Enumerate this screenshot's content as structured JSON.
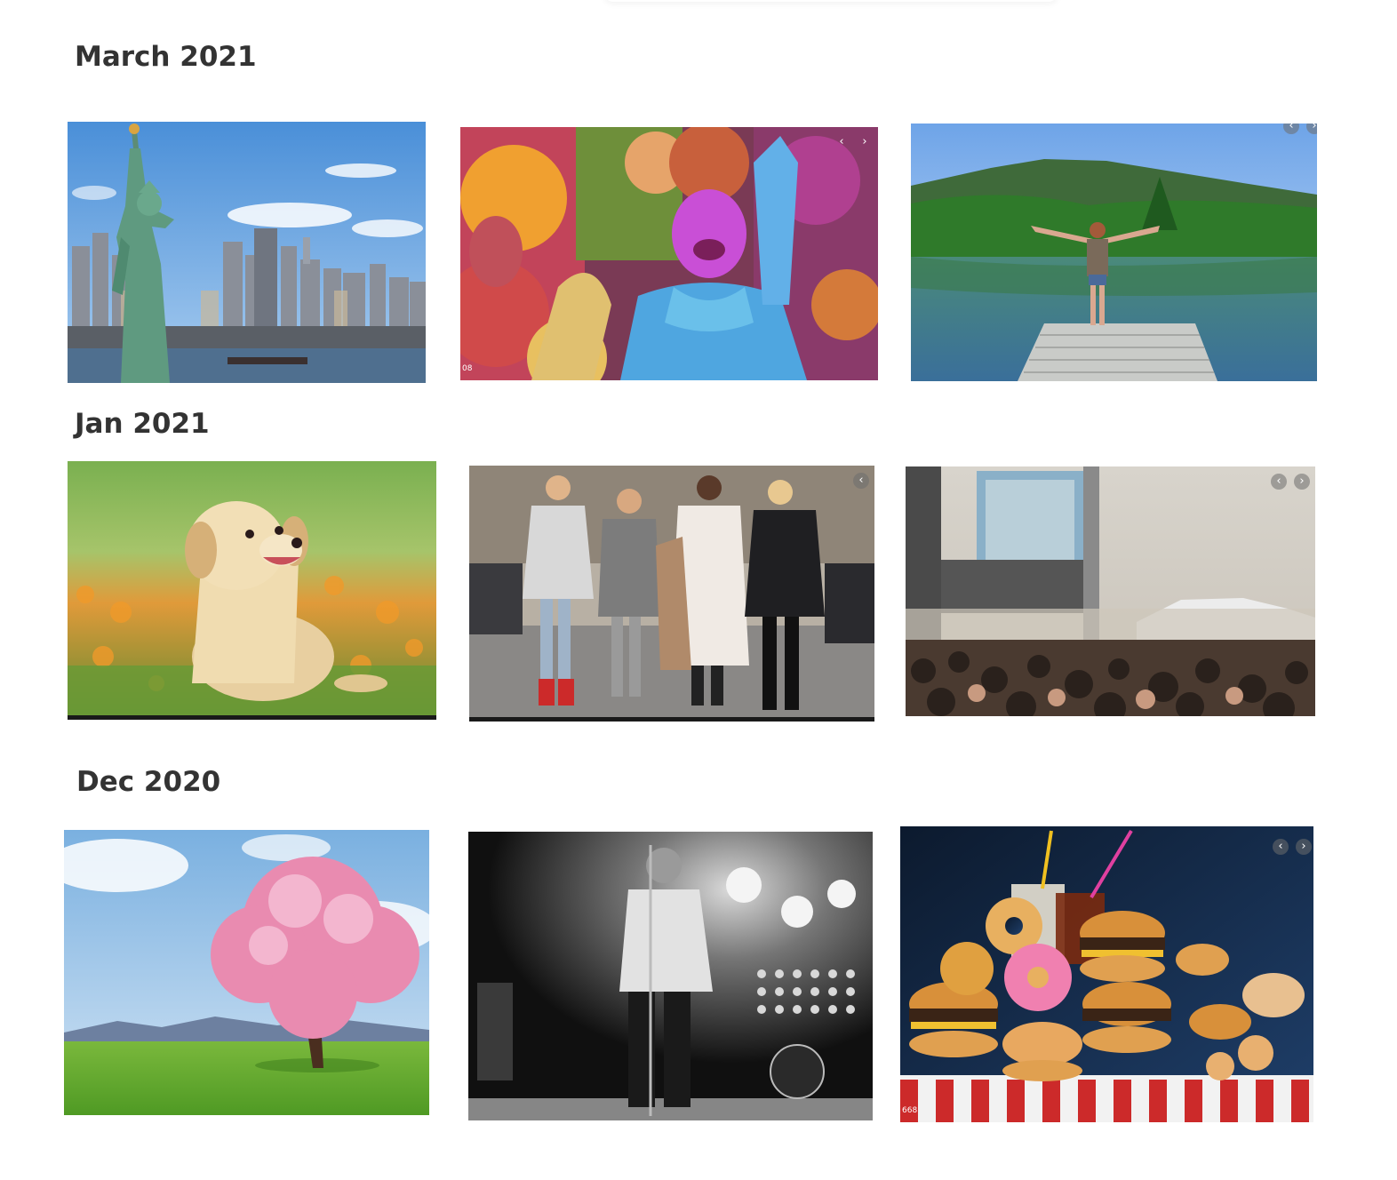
{
  "sections": [
    {
      "title": "March 2021"
    },
    {
      "title": "Jan 2021"
    },
    {
      "title": "Dec 2020"
    }
  ],
  "counters": {
    "holi": "08",
    "food": "668"
  },
  "arrows": {
    "prev": "‹",
    "next": "›"
  },
  "photos": [
    {
      "subject": "statue-of-liberty-skyline"
    },
    {
      "subject": "holi-festival-colors"
    },
    {
      "subject": "hiker-lake-dock"
    },
    {
      "subject": "golden-retriever-puppy"
    },
    {
      "subject": "street-fashion-group"
    },
    {
      "subject": "concert-crowd-festival"
    },
    {
      "subject": "cherry-blossom-tree"
    },
    {
      "subject": "black-white-concert-singer"
    },
    {
      "subject": "fast-food-burgers-donuts"
    }
  ]
}
